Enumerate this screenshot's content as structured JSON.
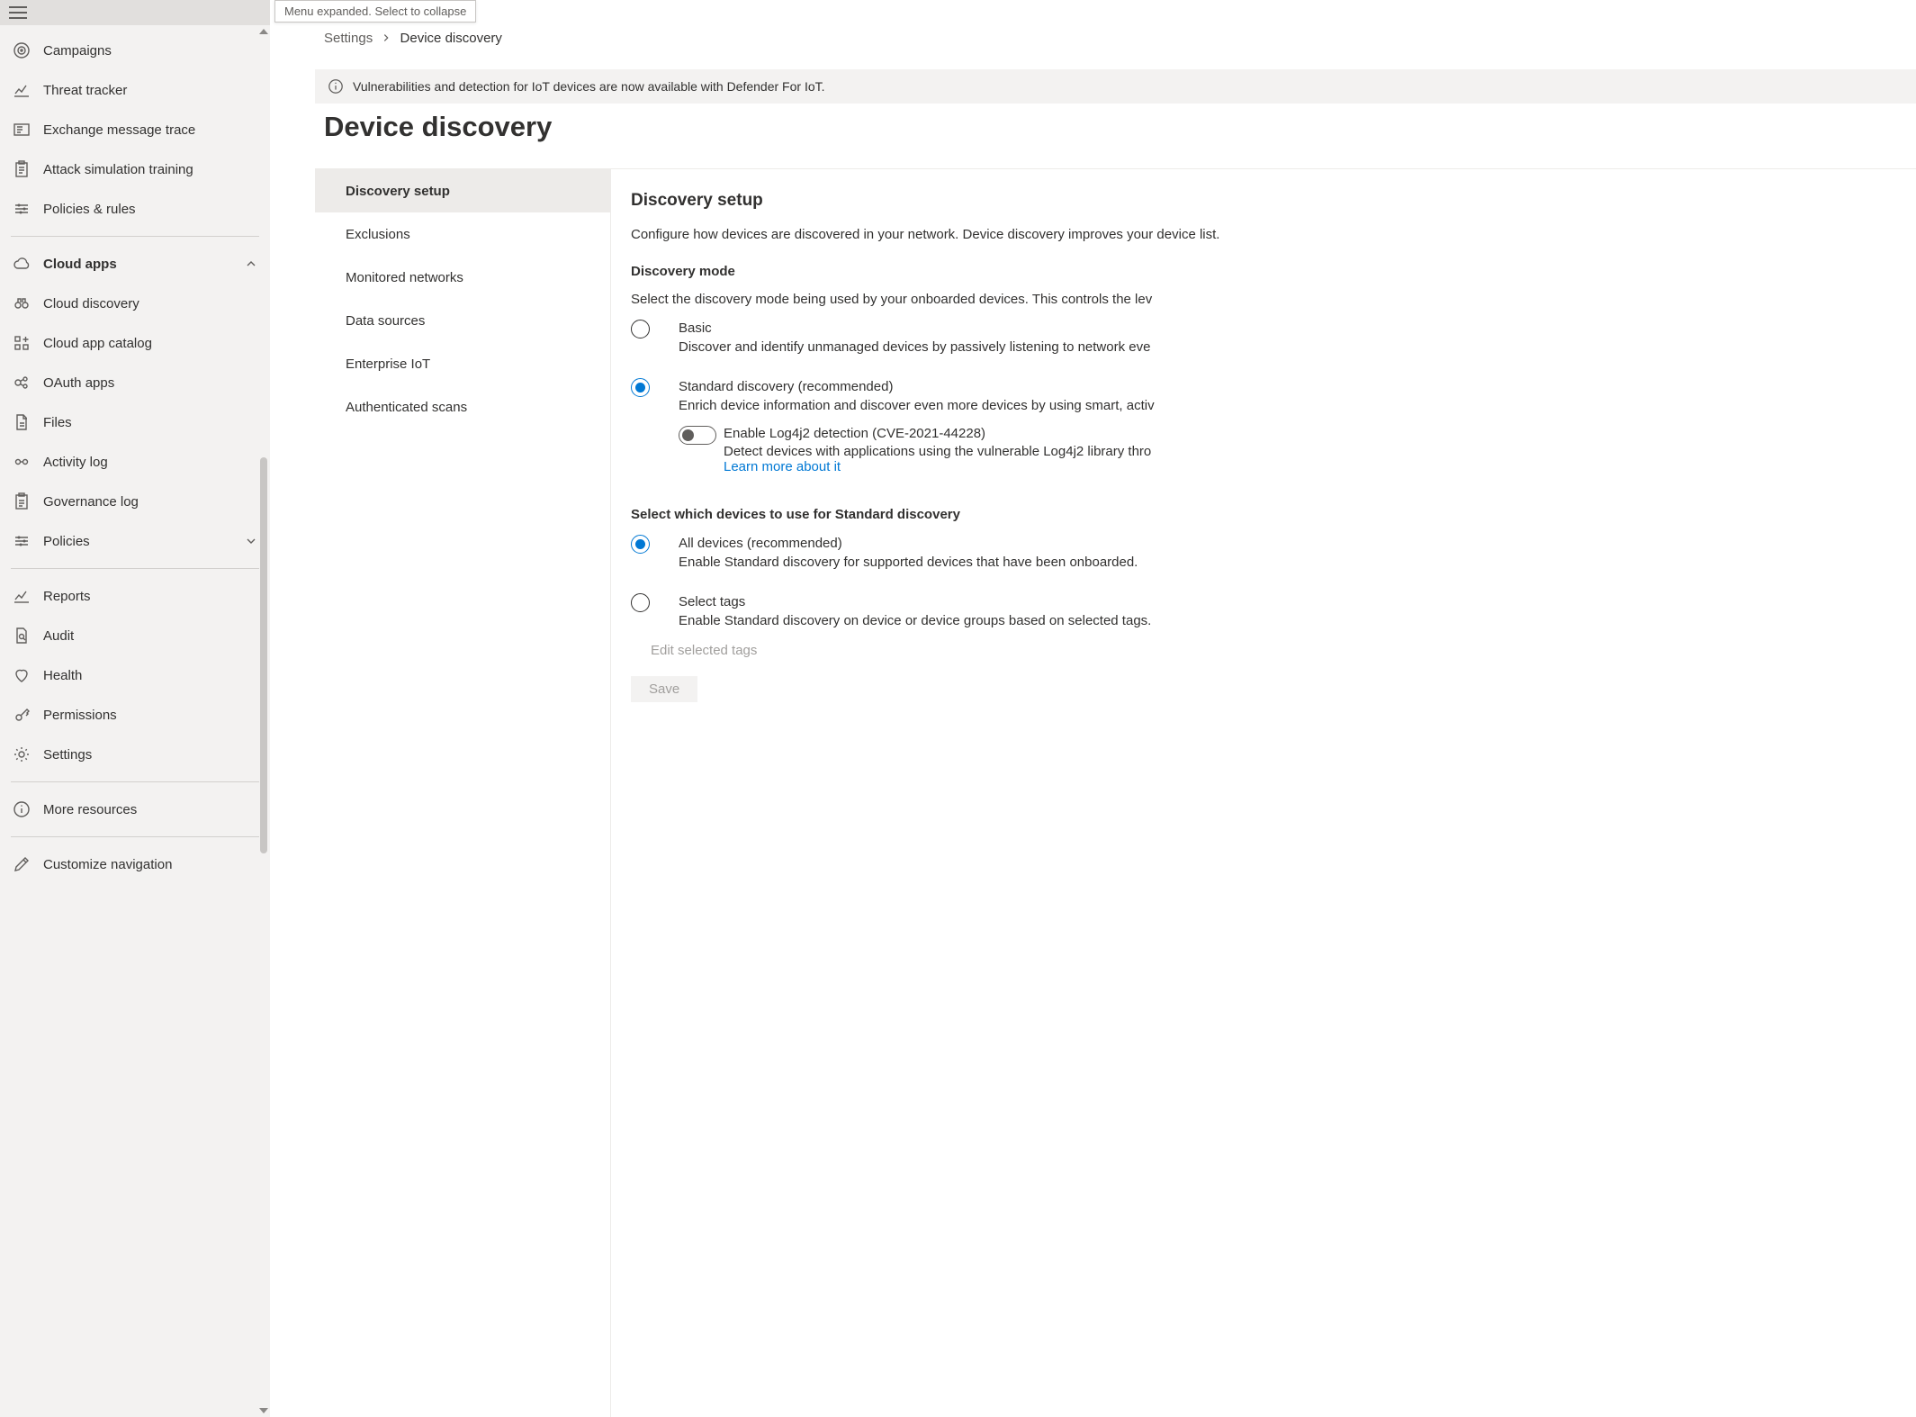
{
  "tooltip": "Menu expanded. Select to collapse",
  "breadcrumb": {
    "root": "Settings",
    "current": "Device discovery"
  },
  "banner": "Vulnerabilities and detection for IoT devices are now available with Defender For IoT.",
  "page_title": "Device discovery",
  "sidebar": {
    "items": [
      {
        "label": "Campaigns",
        "icon": "target"
      },
      {
        "label": "Threat tracker",
        "icon": "chart-line"
      },
      {
        "label": "Exchange message trace",
        "icon": "exchange"
      },
      {
        "label": "Attack simulation training",
        "icon": "clipboard-list"
      },
      {
        "label": "Policies & rules",
        "icon": "sliders"
      },
      {
        "divider": true
      },
      {
        "label": "Cloud apps",
        "icon": "cloud",
        "bold": true,
        "expand": "up"
      },
      {
        "label": "Cloud discovery",
        "icon": "binoculars"
      },
      {
        "label": "Cloud app catalog",
        "icon": "grid-plus"
      },
      {
        "label": "OAuth apps",
        "icon": "oauth"
      },
      {
        "label": "Files",
        "icon": "file"
      },
      {
        "label": "Activity log",
        "icon": "link"
      },
      {
        "label": "Governance log",
        "icon": "clipboard"
      },
      {
        "label": "Policies",
        "icon": "sliders",
        "expand": "down"
      },
      {
        "divider": true
      },
      {
        "label": "Reports",
        "icon": "chart-line"
      },
      {
        "label": "Audit",
        "icon": "file-search"
      },
      {
        "label": "Health",
        "icon": "heart"
      },
      {
        "label": "Permissions",
        "icon": "key"
      },
      {
        "label": "Settings",
        "icon": "gear"
      },
      {
        "divider": true
      },
      {
        "label": "More resources",
        "icon": "info"
      },
      {
        "divider": true
      },
      {
        "label": "Customize navigation",
        "icon": "pencil"
      }
    ]
  },
  "subnav": [
    {
      "label": "Discovery setup",
      "selected": true
    },
    {
      "label": "Exclusions"
    },
    {
      "label": "Monitored networks"
    },
    {
      "label": "Data sources"
    },
    {
      "label": "Enterprise IoT"
    },
    {
      "label": "Authenticated scans"
    }
  ],
  "detail": {
    "heading": "Discovery setup",
    "intro": "Configure how devices are discovered in your network. Device discovery improves your device list.",
    "mode_heading": "Discovery mode",
    "mode_sub": "Select the discovery mode being used by your onboarded devices. This controls the lev",
    "modes": {
      "basic": {
        "title": "Basic",
        "desc": "Discover and identify unmanaged devices by passively listening to network eve",
        "checked": false
      },
      "standard": {
        "title": "Standard discovery (recommended)",
        "desc": "Enrich device information and discover even more devices by using smart, activ",
        "checked": true
      }
    },
    "log4j": {
      "title": "Enable Log4j2 detection (CVE-2021-44228)",
      "desc": "Detect devices with applications using the vulnerable Log4j2 library thro",
      "link": "Learn more about it",
      "enabled": false
    },
    "select_heading": "Select which devices to use for Standard discovery",
    "selector": {
      "all": {
        "title": "All devices (recommended)",
        "desc": "Enable Standard discovery for supported devices that have been onboarded.",
        "checked": true
      },
      "tags": {
        "title": "Select tags",
        "desc": "Enable Standard discovery on device or device groups based on selected tags.",
        "checked": false
      }
    },
    "edit_tags": "Edit selected tags",
    "save": "Save"
  }
}
